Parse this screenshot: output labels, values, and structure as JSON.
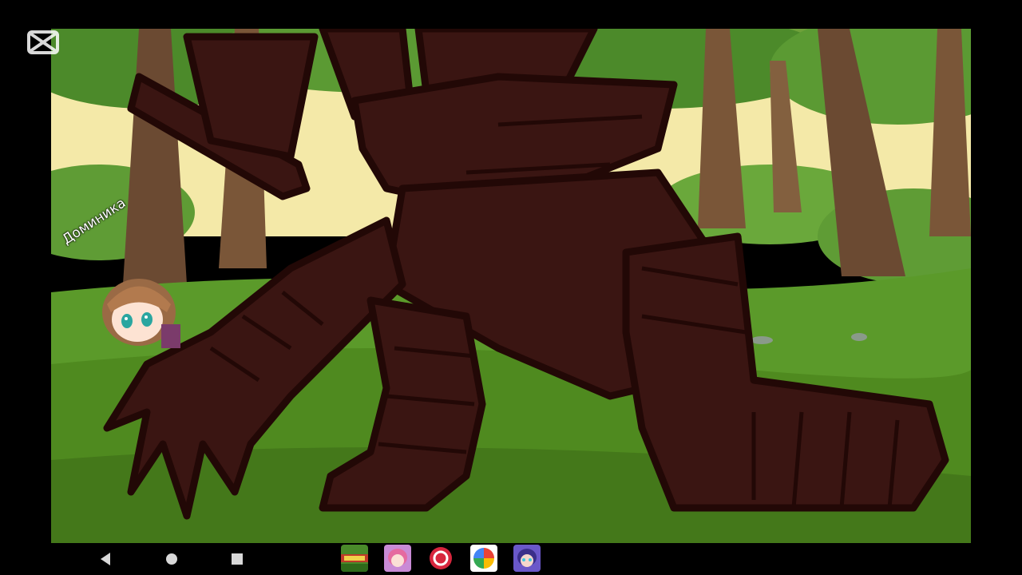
{
  "scene": {
    "character_label": "Доминика",
    "colors": {
      "sky": "#f4e9a8",
      "grass": "#4f8a1f",
      "trunk": "#6b4a32",
      "creature": "#3a1512",
      "creature_outline": "#220806"
    }
  },
  "watermark": {
    "icon": "capcut-icon"
  },
  "navbar": {
    "buttons": [
      {
        "name": "back-button",
        "icon": "triangle-back-icon"
      },
      {
        "name": "home-button",
        "icon": "circle-home-icon"
      },
      {
        "name": "recents-button",
        "icon": "square-recents-icon"
      }
    ],
    "apps": [
      {
        "name": "app-game-1",
        "icon": "pixel-game-icon"
      },
      {
        "name": "app-gacha-1",
        "icon": "gacha-character-icon"
      },
      {
        "name": "app-red-circle",
        "icon": "red-swirl-icon"
      },
      {
        "name": "app-pinwheel",
        "icon": "photos-pinwheel-icon"
      },
      {
        "name": "app-gacha-2",
        "icon": "gacha-character-blue-icon"
      }
    ]
  }
}
